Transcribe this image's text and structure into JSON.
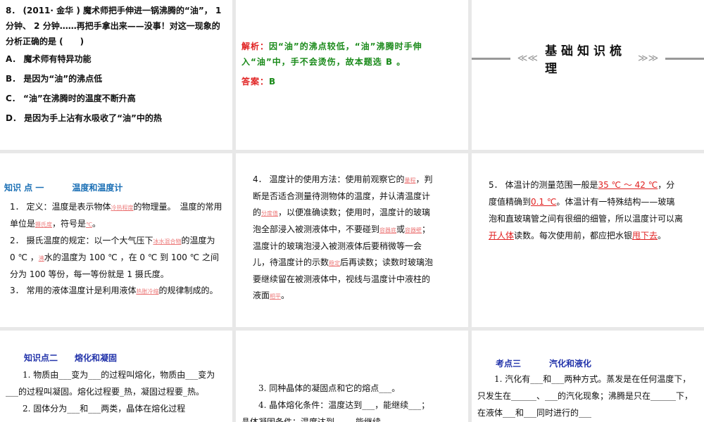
{
  "q8": {
    "stem": "8． (2011· 金华 ) 魔术师把手伸进一锅沸腾的“油”， 1分钟、 2 分钟……再把手拿出来——没事！对这一现象的分析正确的是 (　　)",
    "options": [
      "A． 魔术师有特异功能",
      "B． 是因为“油”的沸点低",
      "C． “油”在沸腾时的温度不断升高",
      "D． 是因为手上沾有水吸收了“油”中的热"
    ]
  },
  "analysis": {
    "label": "解析：",
    "text": "因“油”的沸点较低，“油”沸腾时手伸入“油”中，手不会烫伤，故本题选 B 。",
    "answer_label": "答案：",
    "answer": "B"
  },
  "section_title": {
    "left_arrow": "≪≪",
    "text": "基础知识梳理",
    "right_arrow": "≫≫"
  },
  "kp1": {
    "label": "知识 点 一",
    "title": "温度和温度计",
    "l1a": "1． 定义：温度是表示物体",
    "b1": "冷热程度",
    "l1b": "的物理量。　温度的常用单位是",
    "b2": "摄氏度",
    "l1c": "，符号是",
    "b3": "℃",
    "l1d": "。",
    "l2a": "2． 摄氏温度的规定：以一个大气压下",
    "b4": "冰水混合物",
    "l2b": "的温度为 0 ℃ ，",
    "b5": "沸",
    "l2c": "水的温度为 100 ℃ ，在 0 ℃ 到 100 ℃ 之间分为 100 等份，每一等份就是 1 摄氏度。",
    "l3a": "3． 常用的液体温度计是利用液体",
    "b6": "热胀冷缩",
    "l3b": "的规律制成的。"
  },
  "p4": {
    "a": "4． 温度计的使用方法：使用前观察它的",
    "b1": "量程",
    "b": "，判断是否适合测量待测物体的温度，并认清温度计的",
    "b2": "分度值",
    "c": "，以便准确读数；使用时，温度计的玻璃泡全部浸入被测液体中，不要碰到",
    "b3": "容器底",
    "d": "或",
    "b4": "容器壁",
    "e": "；温度计的玻璃泡浸入被测液体后要稍微等一会儿，待温度计的示数",
    "b5": "稳定",
    "f": "后再读数；读数时玻璃泡要继续留在被测液体中，视线与温度计中液柱的液面",
    "b6": "相平",
    "g": "。"
  },
  "p5": {
    "a": "5． 体温计的测量范围一般是",
    "b1": "35 ℃ ～ 42 ℃",
    "b": "，分度值精确到",
    "b2": "0.1 ℃",
    "c": "。体温计有一特殊结构——玻璃泡和直玻璃管之间有很细的细管，所以温度计可以离",
    "b3": "开人体",
    "d": "读数。每次使用前，都应把水银",
    "b4": "甩下去",
    "e": "。"
  },
  "kp2": {
    "label": "知识点二",
    "title": "熔化和凝固",
    "l1": "1. 物质由___变为___的过程叫熔化，物质由___变为___的过程叫凝固。熔化过程要_热，凝固过程要_热。",
    "l2": "2. 固体分为___和___两类，晶体在熔化过程"
  },
  "p34": {
    "l3": "3. 同种晶体的凝固点和它的熔点___。",
    "l4": "4. 晶体熔化条件：温度达到___，能继续___；",
    "l5": "晶体凝固条件：温度达到___，能继续___"
  },
  "kp3": {
    "label": "考点三",
    "title": "汽化和液化",
    "l1": "1. 汽化有___和___两种方式。蒸发是在任何温度下，只发生在______、___的汽化现象；沸腾是只在______下，在液体___和___同时进行的___"
  }
}
